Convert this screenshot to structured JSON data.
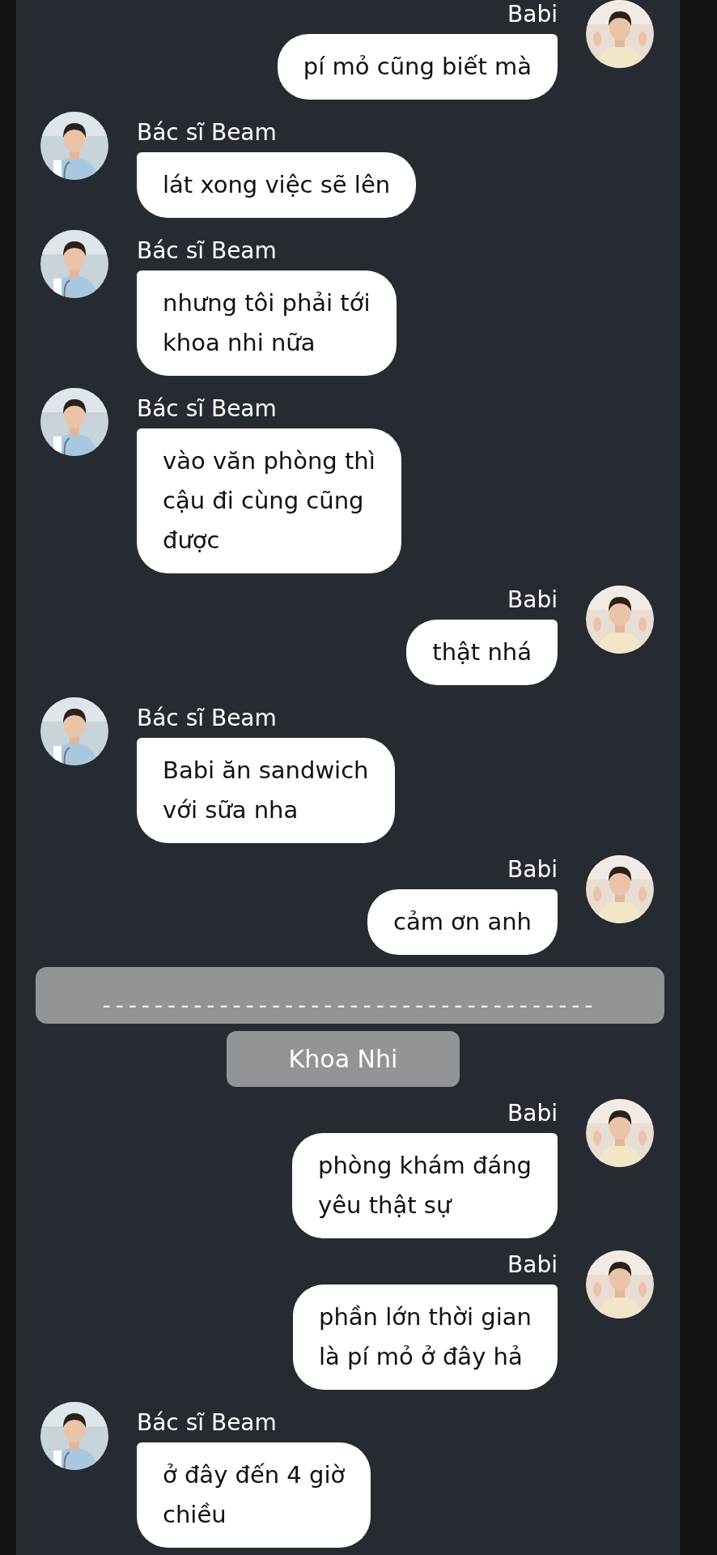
{
  "messages": [
    {
      "kind": "outgoing",
      "sender": "Babi",
      "text": "pí mỏ cũng biết mà"
    },
    {
      "kind": "incoming",
      "sender": "Bác sĩ Beam",
      "text": "lát xong việc sẽ lên"
    },
    {
      "kind": "incoming",
      "sender": "Bác sĩ Beam",
      "text": "nhưng tôi phải tới\nkhoa nhi nữa"
    },
    {
      "kind": "incoming",
      "sender": "Bác sĩ Beam",
      "text": "vào văn phòng thì\ncậu đi cùng cũng\nđược"
    },
    {
      "kind": "outgoing",
      "sender": "Babi",
      "text": "thật nhá"
    },
    {
      "kind": "incoming",
      "sender": "Bác sĩ Beam",
      "text": "Babi ăn sandwich\nvới sữa nha"
    },
    {
      "kind": "outgoing",
      "sender": "Babi",
      "text": "cảm ơn anh"
    },
    {
      "kind": "divider",
      "text": "--------------------------------------"
    },
    {
      "kind": "label",
      "text": "Khoa Nhi"
    },
    {
      "kind": "outgoing",
      "sender": "Babi",
      "text": "phòng khám đáng\nyêu thật sự"
    },
    {
      "kind": "outgoing",
      "sender": "Babi",
      "text": "phần lớn thời gian\nlà pí mỏ ở đây hả"
    },
    {
      "kind": "incoming",
      "sender": "Bác sĩ Beam",
      "text": "ở đây đến 4 giờ\nchiều"
    }
  ]
}
